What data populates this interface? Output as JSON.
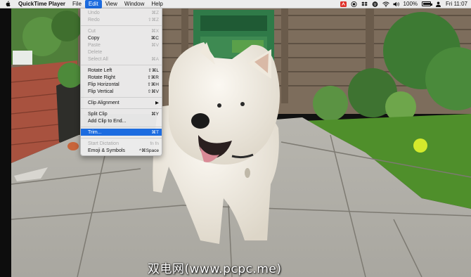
{
  "menubar": {
    "apple_icon": "apple-logo-icon",
    "app_name": "QuickTime Player",
    "menus": [
      "File",
      "Edit",
      "View",
      "Window",
      "Help"
    ],
    "active_menu": "Edit",
    "status": {
      "icons": [
        "adobe-cc-icon",
        "record-icon",
        "dropbox-icon",
        "spotify-icon",
        "wifi-icon",
        "volume-icon"
      ],
      "battery_percent": "100%",
      "battery_level": 1.0,
      "clock": "Fri 11:07"
    }
  },
  "edit_menu": {
    "groups": [
      [
        {
          "label": "Undo",
          "shortcut": "⌘Z",
          "enabled": false
        },
        {
          "label": "Redo",
          "shortcut": "⇧⌘Z",
          "enabled": false
        }
      ],
      [
        {
          "label": "Cut",
          "shortcut": "⌘X",
          "enabled": false
        },
        {
          "label": "Copy",
          "shortcut": "⌘C",
          "enabled": true
        },
        {
          "label": "Paste",
          "shortcut": "⌘V",
          "enabled": false
        },
        {
          "label": "Delete",
          "shortcut": "",
          "enabled": false
        },
        {
          "label": "Select All",
          "shortcut": "⌘A",
          "enabled": false
        }
      ],
      [
        {
          "label": "Rotate Left",
          "shortcut": "⇧⌘L",
          "enabled": true
        },
        {
          "label": "Rotate Right",
          "shortcut": "⇧⌘R",
          "enabled": true
        },
        {
          "label": "Flip Horizontal",
          "shortcut": "⇧⌘H",
          "enabled": true
        },
        {
          "label": "Flip Vertical",
          "shortcut": "⇧⌘V",
          "enabled": true
        }
      ],
      [
        {
          "label": "Clip Alignment",
          "shortcut": "▶",
          "enabled": true
        }
      ],
      [
        {
          "label": "Split Clip",
          "shortcut": "⌘Y",
          "enabled": true
        },
        {
          "label": "Add Clip to End...",
          "shortcut": "",
          "enabled": true
        }
      ],
      [
        {
          "label": "Trim...",
          "shortcut": "⌘T",
          "enabled": true,
          "highlighted": true
        }
      ],
      [
        {
          "label": "Start Dictation",
          "shortcut": "fn fn",
          "enabled": false
        },
        {
          "label": "Emoji & Symbols",
          "shortcut": "^⌘Space",
          "enabled": true
        }
      ]
    ]
  },
  "watermark": {
    "text": "双电网(www.pcpc.me)"
  },
  "colors": {
    "menubar_bg": "#ececec",
    "highlight": "#1c6ce0",
    "lawn": "#4f8f2b",
    "paving": "#b9b7b0",
    "brick": "#a8523f",
    "dog_fur": "#f2eee6"
  }
}
